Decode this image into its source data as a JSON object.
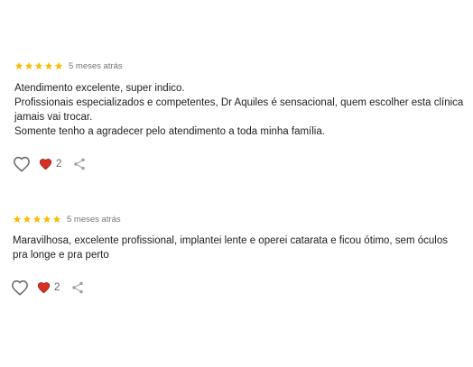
{
  "reviews": [
    {
      "rating": 5,
      "time": "5 meses atrás",
      "lines": [
        "Atendimento excelente, super indico.",
        "Profissionais especializados e competentes, Dr Aquiles é sensacional, quem escolher esta clínica jamais vai trocar.",
        "Somente tenho a agradecer pelo atendimento a toda minha família."
      ],
      "reaction_count": "2"
    },
    {
      "rating": 5,
      "time": "5 meses atrás",
      "lines": [
        "Maravilhosa, excelente profissional, implantei lente e operei catarata e ficou ótimo, sem óculos pra longe e pra perto"
      ],
      "reaction_count": "2"
    }
  ],
  "colors": {
    "star": "#fbbc04",
    "heart": "#d93025",
    "icon_outline": "#5f6368",
    "time_text": "#70757a"
  },
  "icons": [
    "star-icon",
    "like-heart-outline-icon",
    "heart-reaction-icon",
    "share-icon"
  ]
}
